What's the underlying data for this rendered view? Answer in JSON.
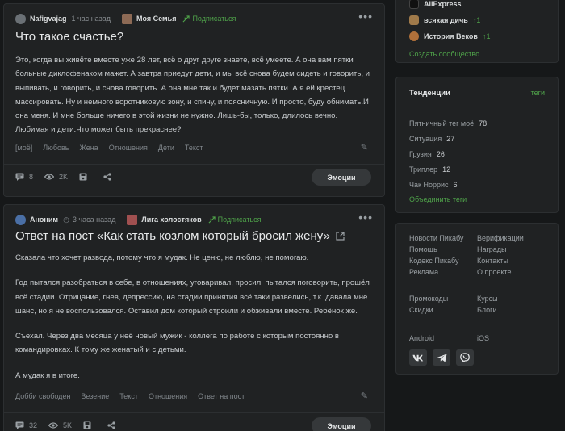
{
  "post1": {
    "author": "Nafigvajag",
    "time": "1 час назад",
    "community": "Моя Семья",
    "subscribe": "Подписаться",
    "title": "Что такое счастье?",
    "body": "Это, когда вы живёте вместе уже 28 лет, всё о друг друге знаете, всё умеете. А она вам пятки больные диклофенаком мажет. А завтра приедут дети, и мы всё снова будем сидеть и говорить, и выпивать, и говорить, и снова говорить. А она мне так и будет мазать пятки. А я ей крестец массировать. Ну и немного воротниковую зону, и спину, и поясничную. И просто, буду обнимать.И она меня. И мне больше ничего в этой жизни не нужно. Лишь-бы, только, длилось вечно. Любимая и дети.Что может быть прекраснее?",
    "tags": [
      "[моё]",
      "Любовь",
      "Жена",
      "Отношения",
      "Дети",
      "Текст"
    ],
    "comments": "8",
    "views": "2K",
    "emotions": "Эмоции"
  },
  "post2": {
    "author": "Аноним",
    "time": "3 часа назад",
    "community": "Лига холостяков",
    "subscribe": "Подписаться",
    "title": "Ответ на пост «Как стать козлом который бросил жену»",
    "paragraphs": [
      "Сказала что хочет развода, потому что я мудак. Не ценю, не люблю, не помогаю.",
      "Год пытался разобраться в себе, в отношениях, уговаривал, просил, пытался поговорить, прошёл всё стадии. Отрицание, гнев, депрессию, на стадии принятия всё таки развелись, т.к. давала мне шанс, но я не воспользовался. Оставил дом который строили и обживали вместе. Ребёнок же.",
      "Съехал. Через два месяца у неё новый мужик - коллега по работе с которым постоянно в командировках. К тому же женатый и с детьми.",
      "А мудак я в итоге."
    ],
    "tags": [
      "Добби свободен",
      "Везение",
      "Текст",
      "Отношения",
      "Ответ на пост"
    ],
    "comments": "32",
    "views": "5K",
    "emotions": "Эмоции"
  },
  "sidebar_communities": {
    "items": [
      {
        "name": "AliExpress",
        "badge": ""
      },
      {
        "name": "всякая дичь",
        "badge": "↑1"
      },
      {
        "name": "История Веков",
        "badge": "↑1"
      }
    ],
    "create": "Создать сообщество"
  },
  "trends": {
    "title": "Тенденции",
    "tags_link": "теги",
    "items": [
      {
        "name": "Пятничный тег моё",
        "count": "78"
      },
      {
        "name": "Ситуация",
        "count": "27"
      },
      {
        "name": "Грузия",
        "count": "26"
      },
      {
        "name": "Триплер",
        "count": "12"
      },
      {
        "name": "Чак Норрис",
        "count": "6"
      }
    ],
    "merge": "Объединить теги"
  },
  "footer": {
    "left": [
      "Новости Пикабу",
      "Помощь",
      "Кодекс Пикабу",
      "Реклама"
    ],
    "right": [
      "Верификации",
      "Награды",
      "Контакты",
      "О проекте"
    ],
    "left2": [
      "Промокоды",
      "Скидки"
    ],
    "right2": [
      "Курсы",
      "Блоги"
    ],
    "android": "Android",
    "ios": "iOS"
  },
  "colors": {
    "accent_green": "#4fa34a",
    "card_bg": "#202223",
    "page_bg": "#161819"
  }
}
